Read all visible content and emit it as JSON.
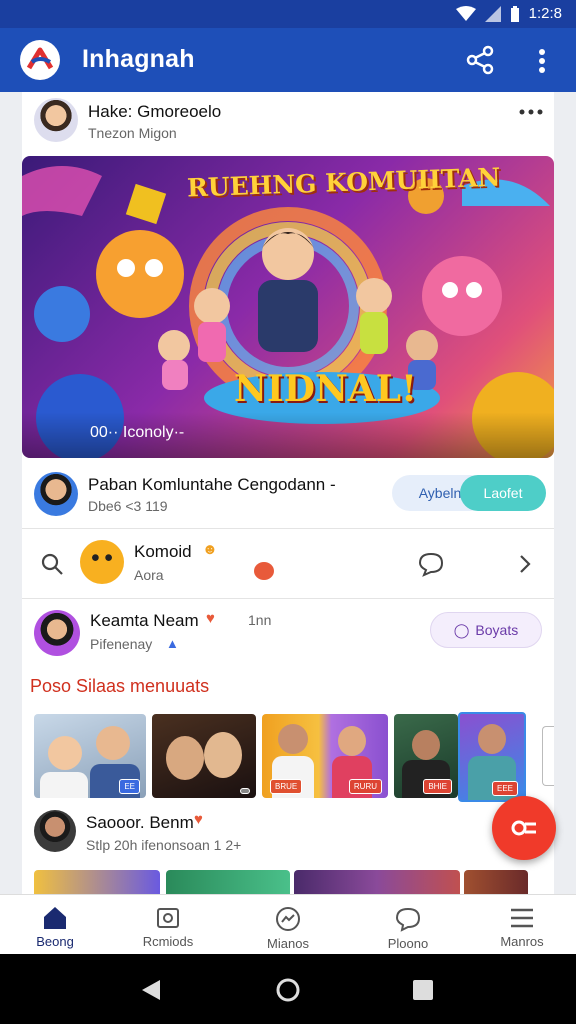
{
  "status": {
    "time": "1:2:8"
  },
  "app": {
    "title": "Inhagnah"
  },
  "post": {
    "author": "Hake: Gmoreoelo",
    "subtitle": "Tnezon Migon",
    "banner_title": "RUEHNG KOMUIITAN",
    "banner_sub": "NIDNAL!",
    "caption": "00·· Iconoly·-"
  },
  "community": {
    "name": "Paban Komluntahe Cengodann -",
    "meta": "Dbe6 <3 119",
    "btn_secondary": "Aybeln",
    "btn_primary": "Laofet"
  },
  "comment_row": {
    "name": "Komoid",
    "meta": "Aora"
  },
  "member": {
    "name": "Keamta Neam",
    "time": "1nn",
    "meta": "Pifenenay",
    "btn": "Boyats"
  },
  "section": {
    "title": "Poso Silaas menuuats"
  },
  "thumbs": [
    "EE",
    "",
    "BRUE",
    "RURU",
    "BHIE",
    "EEE"
  ],
  "post2": {
    "author": "Saooor. Benm",
    "meta": "Stlp 20h ifenonsoan 1 2+"
  },
  "nav": [
    {
      "label": "Beong"
    },
    {
      "label": "Rcmiods"
    },
    {
      "label": "Mianos"
    },
    {
      "label": "Ploono"
    },
    {
      "label": "Manros"
    }
  ],
  "colors": {
    "appbar": "#1e4fb8",
    "accent": "#f03a2a",
    "teal": "#4ecec8"
  }
}
